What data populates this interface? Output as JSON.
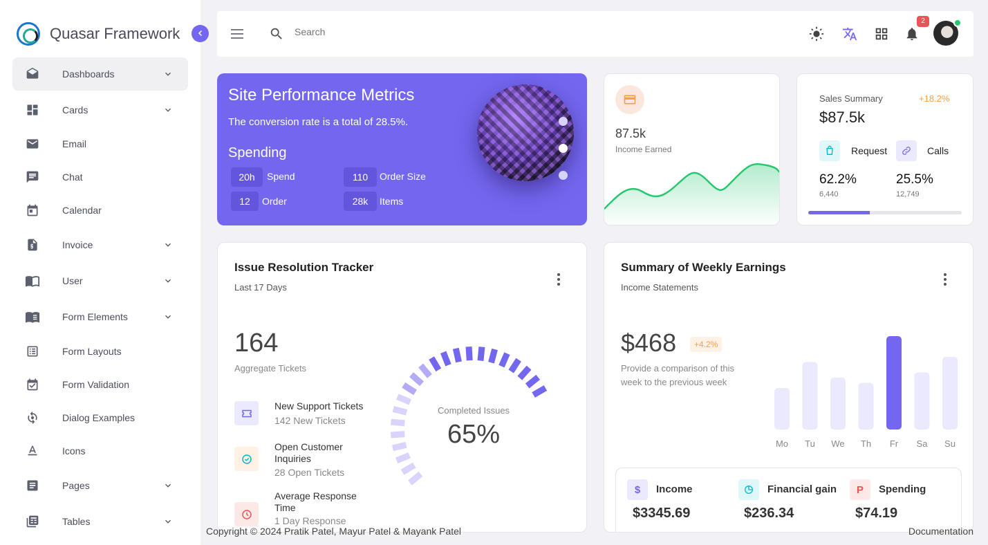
{
  "brand": {
    "name": "Quasar Framework"
  },
  "sidebar": {
    "items": [
      {
        "label": "Dashboards",
        "icon": "envelope-open-icon",
        "has_chevron": true,
        "active": true
      },
      {
        "label": "Cards",
        "icon": "dashboard-icon",
        "has_chevron": true
      },
      {
        "label": "Email",
        "icon": "mail-icon",
        "has_chevron": false
      },
      {
        "label": "Chat",
        "icon": "chat-icon",
        "has_chevron": false
      },
      {
        "label": "Calendar",
        "icon": "calendar-icon",
        "has_chevron": false
      },
      {
        "label": "Invoice",
        "icon": "invoice-icon",
        "has_chevron": true
      },
      {
        "label": "User",
        "icon": "book-open-icon",
        "has_chevron": true
      },
      {
        "label": "Form Elements",
        "icon": "form-elements-icon",
        "has_chevron": true
      },
      {
        "label": "Form Layouts",
        "icon": "list-icon",
        "has_chevron": false
      },
      {
        "label": "Form Validation",
        "icon": "calendar-check-icon",
        "has_chevron": false
      },
      {
        "label": "Dialog Examples",
        "icon": "dialog-icon",
        "has_chevron": false
      },
      {
        "label": "Icons",
        "icon": "text-format-icon",
        "has_chevron": false
      },
      {
        "label": "Pages",
        "icon": "page-icon",
        "has_chevron": true
      },
      {
        "label": "Tables",
        "icon": "table-icon",
        "has_chevron": true
      }
    ]
  },
  "header": {
    "search_placeholder": "Search",
    "notification_count": "2"
  },
  "performance": {
    "title": "Site Performance Metrics",
    "subtitle": "The conversion rate is a total of 28.5%.",
    "section": "Spending",
    "stats": [
      {
        "value": "20h",
        "label": "Spend"
      },
      {
        "value": "110",
        "label": "Order Size"
      },
      {
        "value": "12",
        "label": "Order"
      },
      {
        "value": "28k",
        "label": "Items"
      }
    ]
  },
  "income": {
    "value": "87.5k",
    "label": "Income Earned"
  },
  "sales": {
    "title": "Sales Summary",
    "change": "+18.2%",
    "value": "$87.5k",
    "request_label": "Request",
    "calls_label": "Calls",
    "request_pct": "62.2%",
    "request_count": "6,440",
    "calls_pct": "25.5%",
    "calls_count": "12,749",
    "progress": 0.4
  },
  "tracker": {
    "title": "Issue Resolution Tracker",
    "subtitle": "Last 17 Days",
    "total": "164",
    "total_label": "Aggregate Tickets",
    "items": [
      {
        "title": "New Support Tickets",
        "sub": "142 New Tickets"
      },
      {
        "title": "Open Customer Inquiries",
        "sub": "28 Open Tickets"
      },
      {
        "title": "Average Response Time",
        "sub": "1 Day Response"
      }
    ],
    "gauge_label": "Completed Issues",
    "gauge_value": "65%",
    "gauge_fraction": 0.65
  },
  "weekly": {
    "title": "Summary of Weekly Earnings",
    "subtitle": "Income Statements",
    "value": "$468",
    "change": "+4.2%",
    "description": "Provide a comparison of this week to the previous week",
    "days": [
      "Mo",
      "Tu",
      "We",
      "Th",
      "Fr",
      "Sa",
      "Su"
    ],
    "bar_values": [
      40,
      65,
      50,
      45,
      90,
      55,
      70
    ],
    "highlight_index": 4,
    "summary": [
      {
        "label": "Income",
        "value": "$3345.69"
      },
      {
        "label": "Financial gain",
        "value": "$236.34"
      },
      {
        "label": "Spending",
        "value": "$74.19"
      }
    ]
  },
  "footer": {
    "copyright": "Copyright © 2024 Pratik Patel, Mayur Patel & Mayank Patel",
    "documentation": "Documentation"
  },
  "colors": {
    "primary": "#7367f0",
    "warning": "#ff9f43",
    "danger": "#ea5455",
    "success": "#28c76f",
    "info": "#00bad1"
  }
}
